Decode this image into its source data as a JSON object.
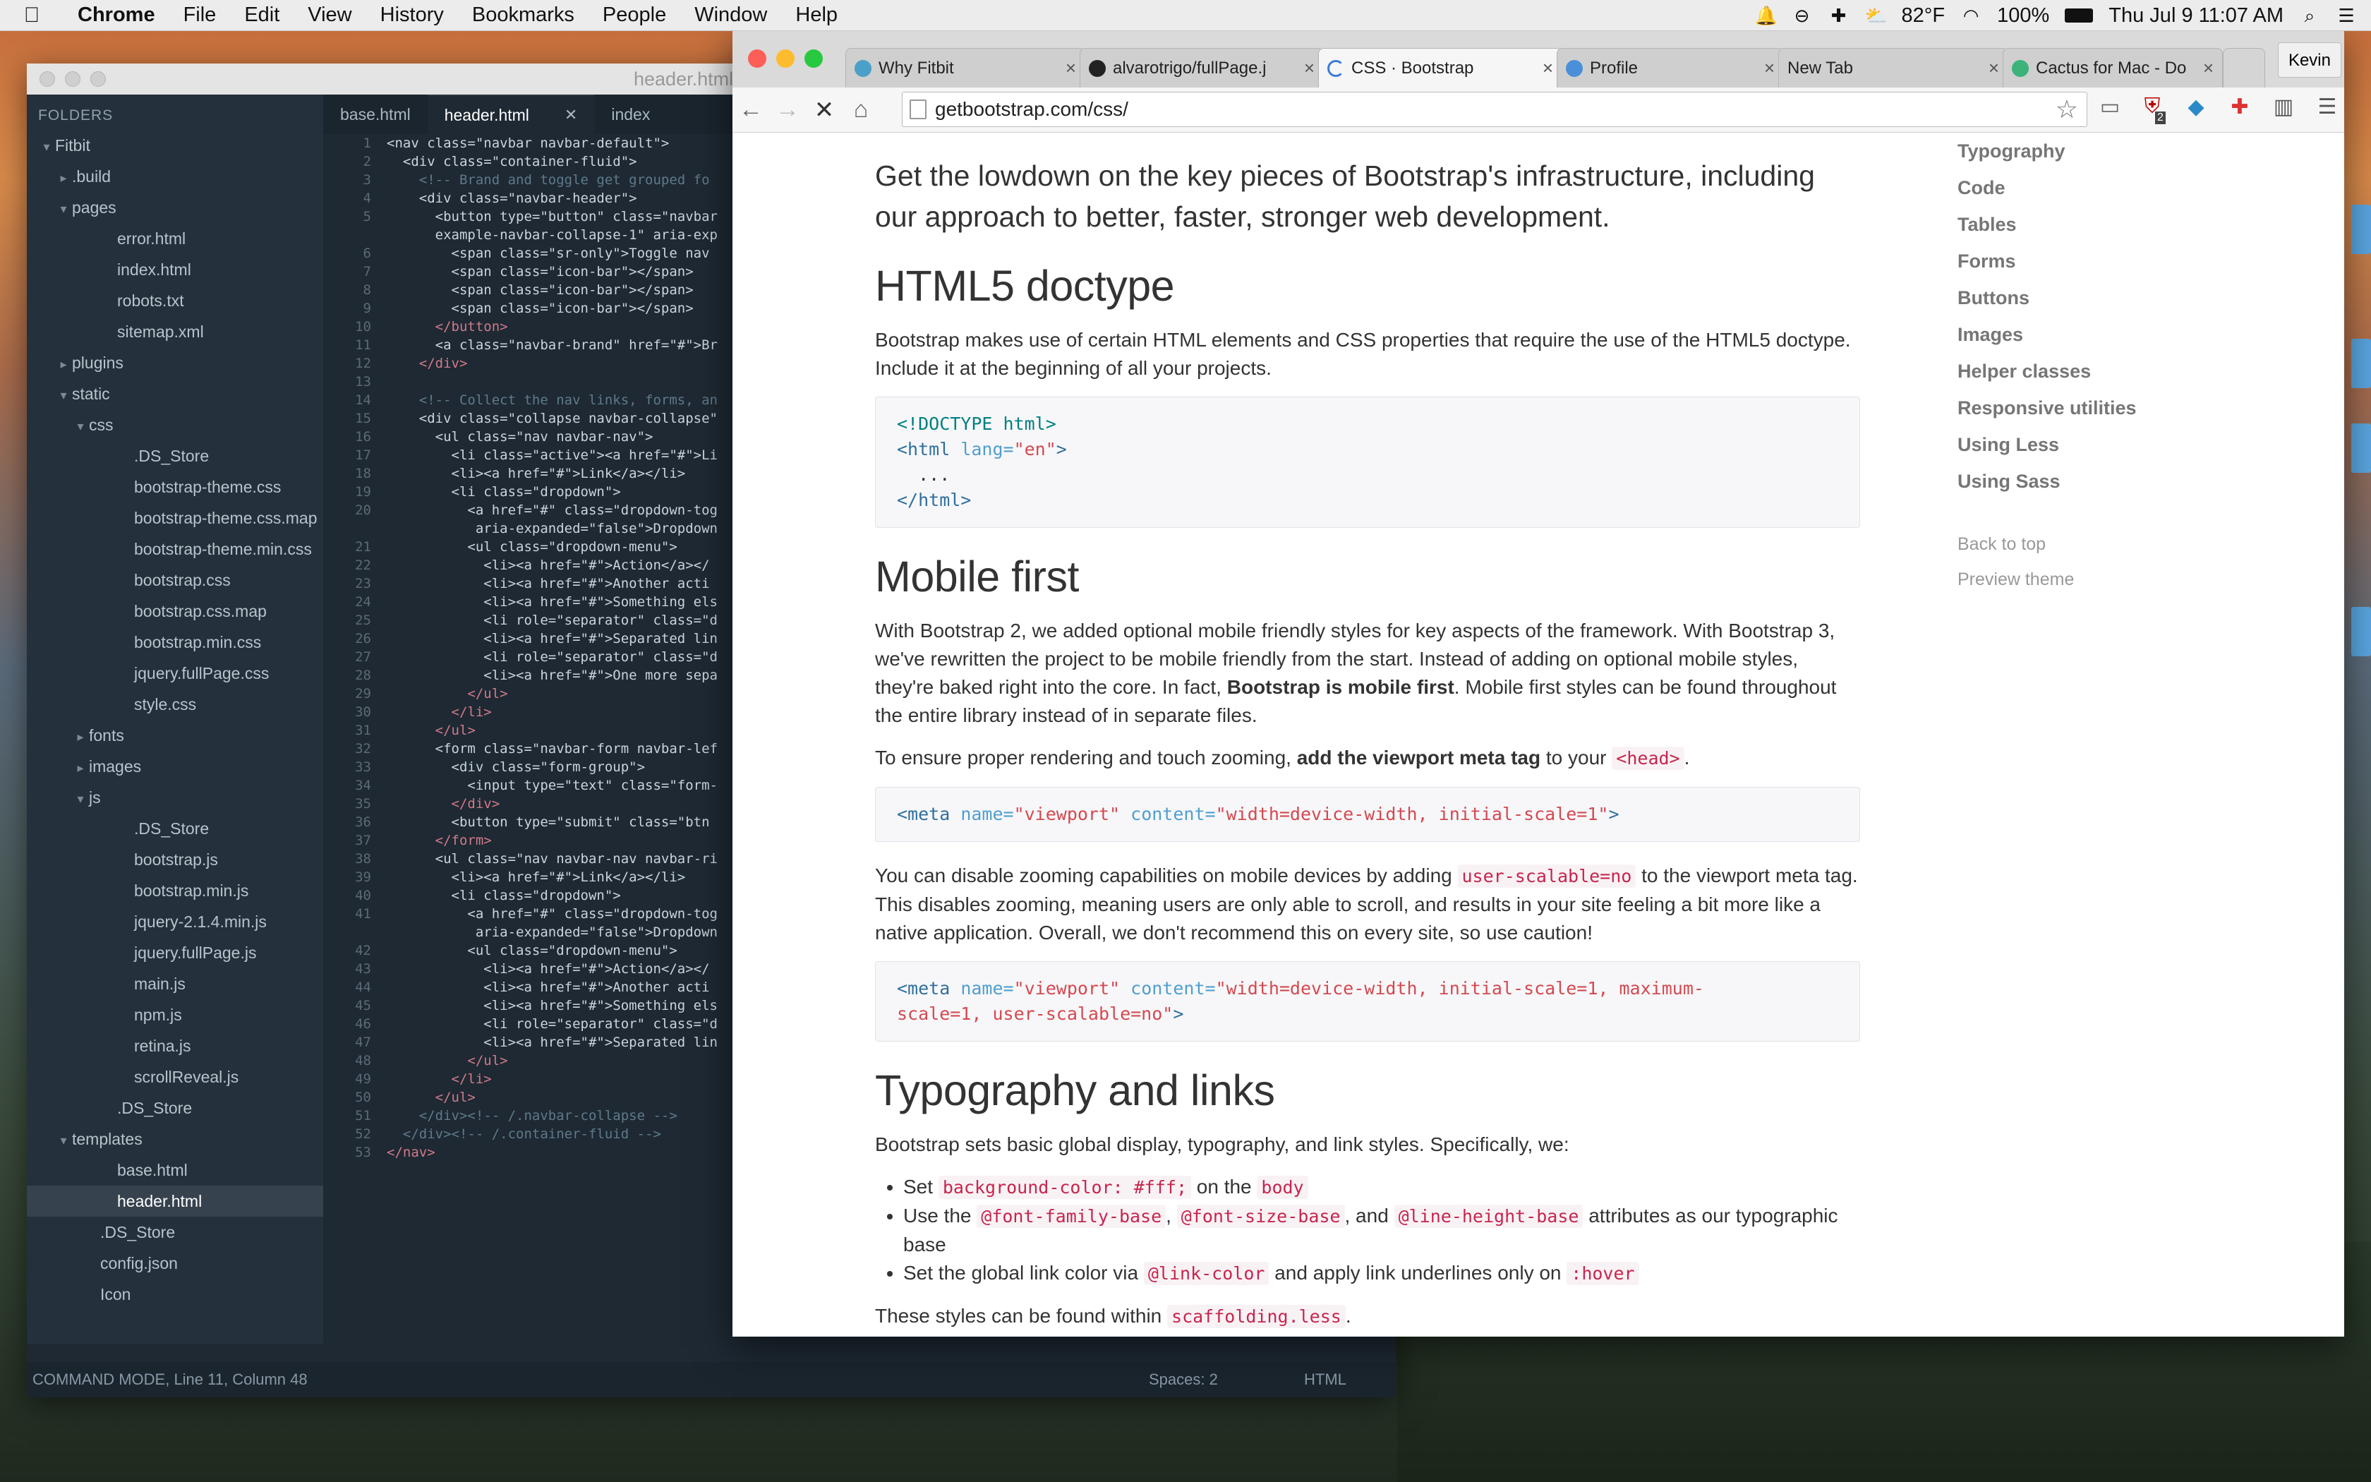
{
  "menubar": {
    "app": "Chrome",
    "items": [
      "File",
      "Edit",
      "View",
      "History",
      "Bookmarks",
      "People",
      "Window",
      "Help"
    ],
    "temperature": "82°F",
    "battery": "100%",
    "datetime": "Thu Jul 9  11:07 AM"
  },
  "editor": {
    "window_title": "header.html",
    "folders_heading": "FOLDERS",
    "tree": [
      {
        "label": "Fitbit",
        "indent": 0,
        "arrow": "▾"
      },
      {
        "label": ".build",
        "indent": 1,
        "arrow": "▸"
      },
      {
        "label": "pages",
        "indent": 1,
        "arrow": "▾"
      },
      {
        "label": "error.html",
        "indent": 2,
        "arrow": ""
      },
      {
        "label": "index.html",
        "indent": 2,
        "arrow": ""
      },
      {
        "label": "robots.txt",
        "indent": 2,
        "arrow": ""
      },
      {
        "label": "sitemap.xml",
        "indent": 2,
        "arrow": ""
      },
      {
        "label": "plugins",
        "indent": 1,
        "arrow": "▸"
      },
      {
        "label": "static",
        "indent": 1,
        "arrow": "▾"
      },
      {
        "label": "css",
        "indent": 2,
        "arrow": "▾"
      },
      {
        "label": ".DS_Store",
        "indent": 3,
        "arrow": ""
      },
      {
        "label": "bootstrap-theme.css",
        "indent": 3,
        "arrow": ""
      },
      {
        "label": "bootstrap-theme.css.map",
        "indent": 3,
        "arrow": ""
      },
      {
        "label": "bootstrap-theme.min.css",
        "indent": 3,
        "arrow": ""
      },
      {
        "label": "bootstrap.css",
        "indent": 3,
        "arrow": ""
      },
      {
        "label": "bootstrap.css.map",
        "indent": 3,
        "arrow": ""
      },
      {
        "label": "bootstrap.min.css",
        "indent": 3,
        "arrow": ""
      },
      {
        "label": "jquery.fullPage.css",
        "indent": 3,
        "arrow": ""
      },
      {
        "label": "style.css",
        "indent": 3,
        "arrow": ""
      },
      {
        "label": "fonts",
        "indent": 2,
        "arrow": "▸"
      },
      {
        "label": "images",
        "indent": 2,
        "arrow": "▸"
      },
      {
        "label": "js",
        "indent": 2,
        "arrow": "▾"
      },
      {
        "label": ".DS_Store",
        "indent": 3,
        "arrow": ""
      },
      {
        "label": "bootstrap.js",
        "indent": 3,
        "arrow": ""
      },
      {
        "label": "bootstrap.min.js",
        "indent": 3,
        "arrow": ""
      },
      {
        "label": "jquery-2.1.4.min.js",
        "indent": 3,
        "arrow": ""
      },
      {
        "label": "jquery.fullPage.js",
        "indent": 3,
        "arrow": ""
      },
      {
        "label": "main.js",
        "indent": 3,
        "arrow": ""
      },
      {
        "label": "npm.js",
        "indent": 3,
        "arrow": ""
      },
      {
        "label": "retina.js",
        "indent": 3,
        "arrow": ""
      },
      {
        "label": "scrollReveal.js",
        "indent": 3,
        "arrow": ""
      },
      {
        "label": ".DS_Store",
        "indent": 2,
        "arrow": ""
      },
      {
        "label": "templates",
        "indent": 1,
        "arrow": "▾"
      },
      {
        "label": "base.html",
        "indent": 2,
        "arrow": ""
      },
      {
        "label": "header.html",
        "indent": 2,
        "arrow": "",
        "selected": true
      },
      {
        "label": ".DS_Store",
        "indent": 1,
        "arrow": ""
      },
      {
        "label": "config.json",
        "indent": 1,
        "arrow": ""
      },
      {
        "label": "Icon",
        "indent": 1,
        "arrow": ""
      }
    ],
    "tabs": [
      {
        "label": "base.html",
        "active": false
      },
      {
        "label": "header.html",
        "active": true
      },
      {
        "label": "index",
        "active": false
      }
    ],
    "gutter": [
      "1",
      "2",
      "3",
      "4",
      "5",
      "",
      "6",
      "7",
      "8",
      "9",
      "10",
      "11",
      "12",
      "13",
      "14",
      "15",
      "16",
      "17",
      "18",
      "19",
      "20",
      "",
      "21",
      "22",
      "23",
      "24",
      "25",
      "26",
      "27",
      "28",
      "29",
      "30",
      "31",
      "32",
      "33",
      "34",
      "35",
      "36",
      "37",
      "38",
      "39",
      "40",
      "41",
      "",
      "42",
      "43",
      "44",
      "45",
      "46",
      "47",
      "48",
      "49",
      "50",
      "51",
      "52",
      "53"
    ],
    "code": [
      "<nav class=\"navbar navbar-default\">",
      "  <div class=\"container-fluid\">",
      "    <!-- Brand and toggle get grouped fo",
      "    <div class=\"navbar-header\">",
      "      <button type=\"button\" class=\"navbar",
      "      example-navbar-collapse-1\" aria-exp",
      "        <span class=\"sr-only\">Toggle nav",
      "        <span class=\"icon-bar\"></span>",
      "        <span class=\"icon-bar\"></span>",
      "        <span class=\"icon-bar\"></span>",
      "      </button>",
      "      <a class=\"navbar-brand\" href=\"#\">Br",
      "    </div>",
      "",
      "    <!-- Collect the nav links, forms, an",
      "    <div class=\"collapse navbar-collapse\"",
      "      <ul class=\"nav navbar-nav\">",
      "        <li class=\"active\"><a href=\"#\">Li",
      "        <li><a href=\"#\">Link</a></li>",
      "        <li class=\"dropdown\">",
      "          <a href=\"#\" class=\"dropdown-tog",
      "           aria-expanded=\"false\">Dropdown",
      "          <ul class=\"dropdown-menu\">",
      "            <li><a href=\"#\">Action</a></",
      "            <li><a href=\"#\">Another acti",
      "            <li><a href=\"#\">Something els",
      "            <li role=\"separator\" class=\"d",
      "            <li><a href=\"#\">Separated lin",
      "            <li role=\"separator\" class=\"d",
      "            <li><a href=\"#\">One more sepa",
      "          </ul>",
      "        </li>",
      "      </ul>",
      "      <form class=\"navbar-form navbar-lef",
      "        <div class=\"form-group\">",
      "          <input type=\"text\" class=\"form-",
      "        </div>",
      "        <button type=\"submit\" class=\"btn",
      "      </form>",
      "      <ul class=\"nav navbar-nav navbar-ri",
      "        <li><a href=\"#\">Link</a></li>",
      "        <li class=\"dropdown\">",
      "          <a href=\"#\" class=\"dropdown-tog",
      "           aria-expanded=\"false\">Dropdown",
      "          <ul class=\"dropdown-menu\">",
      "            <li><a href=\"#\">Action</a></",
      "            <li><a href=\"#\">Another acti",
      "            <li><a href=\"#\">Something els",
      "            <li role=\"separator\" class=\"d",
      "            <li><a href=\"#\">Separated lin",
      "          </ul>",
      "        </li>",
      "      </ul>",
      "    </div><!-- /.navbar-collapse -->",
      "  </div><!-- /.container-fluid -->",
      "</nav>"
    ],
    "status_left": "COMMAND MODE, Line 11, Column 48",
    "status_spaces": "Spaces: 2",
    "status_lang": "HTML"
  },
  "chrome": {
    "tabs": [
      {
        "label": "Why Fitbit",
        "color": "#4aa0c8",
        "active": false
      },
      {
        "label": "alvarotrigo/fullPage.j",
        "color": "#222222",
        "active": false
      },
      {
        "label": "CSS · Bootstrap",
        "color": "#3b7bd4",
        "active": true
      },
      {
        "label": "Profile",
        "color": "#4a90d9",
        "active": false
      },
      {
        "label": "New Tab",
        "color": "",
        "active": false
      },
      {
        "label": "Cactus for Mac - Do",
        "color": "#3bb37a",
        "active": false
      }
    ],
    "profile_name": "Kevin",
    "url": "getbootstrap.com/css/",
    "extension_badge": "2"
  },
  "page": {
    "lead": "Get the lowdown on the key pieces of Bootstrap's infrastructure, including our approach to better, faster, stronger web development.",
    "h_doctype": "HTML5 doctype",
    "p_doctype": "Bootstrap makes use of certain HTML elements and CSS properties that require the use of the HTML5 doctype. Include it at the beginning of all your projects.",
    "code_doctype_1": "<!DOCTYPE html>",
    "code_doctype_2a": "<html ",
    "code_doctype_2b": "lang=",
    "code_doctype_2c": "\"en\"",
    "code_doctype_2d": ">",
    "code_doctype_3": "  ...",
    "code_doctype_4": "</html>",
    "h_mobile": "Mobile first",
    "p_mobile_a": "With Bootstrap 2, we added optional mobile friendly styles for key aspects of the framework. With Bootstrap 3, we've rewritten the project to be mobile friendly from the start. Instead of adding on optional mobile styles, they're baked right into the core. In fact, ",
    "p_mobile_b": "Bootstrap is mobile first",
    "p_mobile_c": ". Mobile first styles can be found throughout the entire library instead of in separate files.",
    "p_vp_a": "To ensure proper rendering and touch zooming, ",
    "p_vp_b": "add the viewport meta tag",
    "p_vp_c": " to your ",
    "p_vp_code": "<head>",
    "p_vp_d": ".",
    "code_meta_tag": "<meta ",
    "code_meta_name_attr": "name=",
    "code_meta_name_val": "\"viewport\"",
    "code_meta_content_attr": " content=",
    "code_meta1_val": "\"width=device-width, initial-scale=1\"",
    "code_meta_close": ">",
    "p_zoom_a": "You can disable zooming capabilities on mobile devices by adding ",
    "p_zoom_code": "user-scalable=no",
    "p_zoom_b": " to the viewport meta tag. This disables zooming, meaning users are only able to scroll, and results in your site feeling a bit more like a native application. Overall, we don't recommend this on every site, so use caution!",
    "code_meta2_val_a": "\"width=device-width, initial-scale=1, maximum-",
    "code_meta2_val_b": "scale=1, user-scalable=no\"",
    "h_typo": "Typography and links",
    "p_typo": "Bootstrap sets basic global display, typography, and link styles. Specifically, we:",
    "li1_a": "Set ",
    "li1_code1": "background-color: #fff;",
    "li1_b": " on the ",
    "li1_code2": "body",
    "li2_a": "Use the ",
    "li2_code1": "@font-family-base",
    "li2_b": ", ",
    "li2_code2": "@font-size-base",
    "li2_c": ", and ",
    "li2_code3": "@line-height-base",
    "li2_d": " attributes as our typographic base",
    "li3_a": "Set the global link color via ",
    "li3_code1": "@link-color",
    "li3_b": " and apply link underlines only on ",
    "li3_code2": ":hover",
    "p_found_a": "These styles can be found within ",
    "p_found_code": "scaffolding.less",
    "p_found_b": ".",
    "sidenav": [
      "Typography",
      "Code",
      "Tables",
      "Forms",
      "Buttons",
      "Images",
      "Helper classes",
      "Responsive utilities",
      "Using Less",
      "Using Sass"
    ],
    "back_to_top": "Back to top",
    "preview_theme": "Preview theme"
  }
}
